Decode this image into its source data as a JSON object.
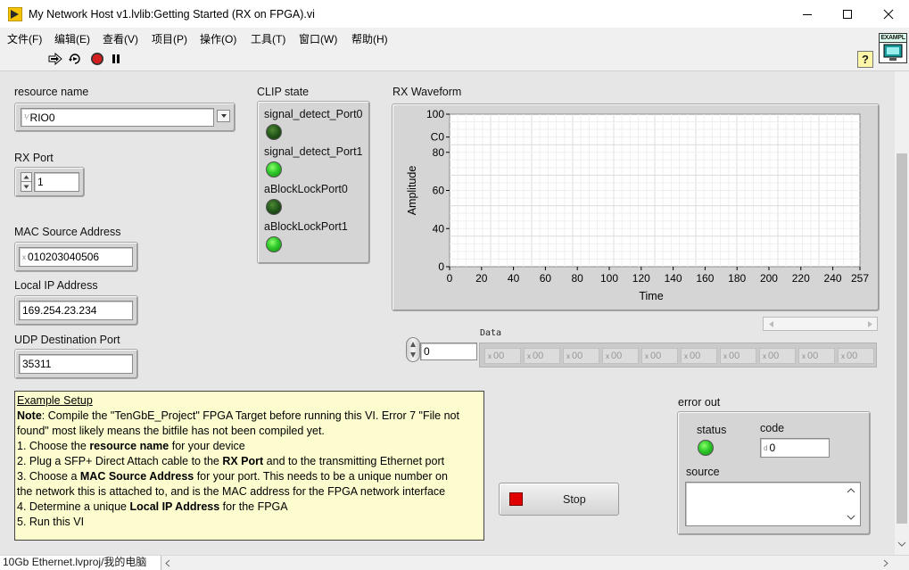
{
  "window": {
    "title": "My Network Host v1.lvlib:Getting Started (RX on FPGA).vi",
    "minimize_icon": "minimize-icon",
    "maximize_icon": "maximize-icon",
    "close_icon": "close-icon"
  },
  "menubar": {
    "items": [
      "文件(F)",
      "编辑(E)",
      "查看(V)",
      "项目(P)",
      "操作(O)",
      "工具(T)",
      "窗口(W)",
      "帮助(H)"
    ]
  },
  "toolbar": {
    "icons": [
      "run-arrow-icon",
      "run-continuously-icon",
      "abort-icon",
      "pause-icon"
    ],
    "help_label": "?",
    "vi_icon_label": "EXAMPL"
  },
  "controls": {
    "resource_name": {
      "label": "resource name",
      "value": "RIO0"
    },
    "rx_port": {
      "label": "RX Port",
      "value": "1"
    },
    "mac_source": {
      "label": "MAC Source Address",
      "radix": "x",
      "value": "010203040506"
    },
    "local_ip": {
      "label": "Local IP Address",
      "value": "169.254.23.234"
    },
    "udp_dest_port": {
      "label": "UDP Destination Port",
      "value": "35311"
    }
  },
  "clip_state": {
    "label": "CLIP state",
    "items": [
      {
        "label": "signal_detect_Port0",
        "state": "off"
      },
      {
        "label": "signal_detect_Port1",
        "state": "on"
      },
      {
        "label": "aBlockLockPort0",
        "state": "off"
      },
      {
        "label": "aBlockLockPort1",
        "state": "on"
      }
    ]
  },
  "chart_data": {
    "type": "line",
    "title": "RX Waveform",
    "xlabel": "Time",
    "ylabel": "Amplitude",
    "xlim": [
      0,
      257
    ],
    "ylim": [
      0,
      100
    ],
    "x_ticks": [
      "0",
      "20",
      "40",
      "60",
      "80",
      "100",
      "120",
      "140",
      "160",
      "180",
      "200",
      "220",
      "240",
      "257"
    ],
    "y_ticks": [
      "100",
      "C0",
      "80",
      "60",
      "40",
      "0"
    ],
    "series": [],
    "grid": true
  },
  "data_array": {
    "label": "Data",
    "index": "0",
    "cell_radix": "x",
    "cells": [
      "00",
      "00",
      "00",
      "00",
      "00",
      "00",
      "00",
      "00",
      "00",
      "00"
    ]
  },
  "note": {
    "heading": "Example Setup",
    "lines": [
      [
        {
          "t": "Note",
          "b": true
        },
        {
          "t": ": Compile the \"TenGbE_Project\" FPGA Target before running this VI. Error 7 \"File not"
        }
      ],
      [
        {
          "t": "found\" most likely means the bitfile has not been compiled yet."
        }
      ],
      [
        {
          "t": " "
        }
      ],
      [
        {
          "t": "1. Choose the "
        },
        {
          "t": "resource name",
          "b": true
        },
        {
          "t": " for your device"
        }
      ],
      [
        {
          "t": "2. Plug a SFP+ Direct Attach cable to the "
        },
        {
          "t": "RX Port",
          "b": true
        },
        {
          "t": " and to the transmitting Ethernet port"
        }
      ],
      [
        {
          "t": "3. Choose a "
        },
        {
          "t": "MAC Source Address",
          "b": true
        },
        {
          "t": " for your port.  This needs to be a unique number on"
        }
      ],
      [
        {
          "t": "the network this is attached to, and is the MAC address for the FPGA network interface"
        }
      ],
      [
        {
          "t": "4. Determine a unique "
        },
        {
          "t": "Local IP Address",
          "b": true
        },
        {
          "t": " for the FPGA"
        }
      ],
      [
        {
          "t": "5. Run this VI"
        }
      ]
    ]
  },
  "stop_button": {
    "label": "Stop",
    "color": "#e00000"
  },
  "error_out": {
    "label": "error out",
    "status_label": "status",
    "code_label": "code",
    "code_radix": "d",
    "code_value": "0",
    "source_label": "source",
    "source_value": ""
  },
  "statusbar": {
    "text": "10Gb Ethernet.lvproj/我的电脑"
  }
}
